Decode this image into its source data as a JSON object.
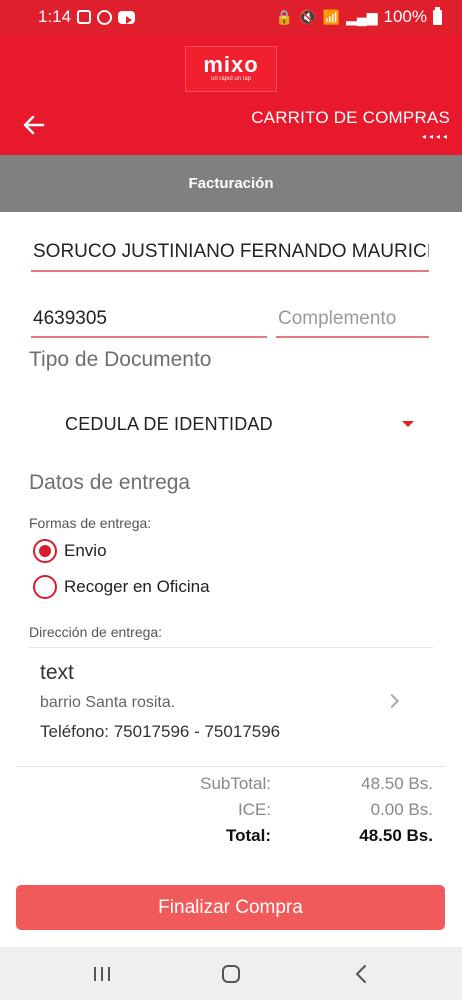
{
  "status_bar": {
    "time": "1:14",
    "battery": "100%",
    "icons": [
      "gallery-icon",
      "b-badge-icon",
      "youtube-icon",
      "lock-icon",
      "mute-icon",
      "wifi-icon",
      "signal-icon",
      "battery-icon"
    ]
  },
  "header": {
    "logo_word": "mixo",
    "logo_tagline": "un rapid un tap",
    "title": "CARRITO DE COMPRAS",
    "dots": "◂◂◂◂",
    "color": "#e8192c"
  },
  "section": {
    "title": "Facturación"
  },
  "form": {
    "name_value": "SORUCO JUSTINIANO FERNANDO MAURICIO",
    "ci_value": "4639305",
    "complemento_placeholder": "Complemento",
    "tipo_label": "Tipo de Documento",
    "tipo_value": "CEDULA DE IDENTIDAD"
  },
  "delivery": {
    "title": "Datos de entrega",
    "formas_label": "Formas de entrega:",
    "options": [
      {
        "label": "Envio",
        "selected": true
      },
      {
        "label": "Recoger en Oficina",
        "selected": false
      }
    ],
    "address_label": "Dirección de entrega:",
    "address": {
      "title": "text",
      "line": "barrio Santa rosita.",
      "phone": "Teléfono: 75017596 - 75017596"
    }
  },
  "totals": {
    "subtotal_label": "SubTotal:",
    "subtotal_value": "48.50 Bs.",
    "ice_label": "ICE:",
    "ice_value": "0.00 Bs.",
    "total_label": "Total:",
    "total_value": "48.50 Bs."
  },
  "actions": {
    "finish_label": "Finalizar Compra",
    "finish_color": "#f15a5b"
  },
  "nav": {
    "icons": [
      "recents-icon",
      "home-icon",
      "back-icon"
    ]
  }
}
